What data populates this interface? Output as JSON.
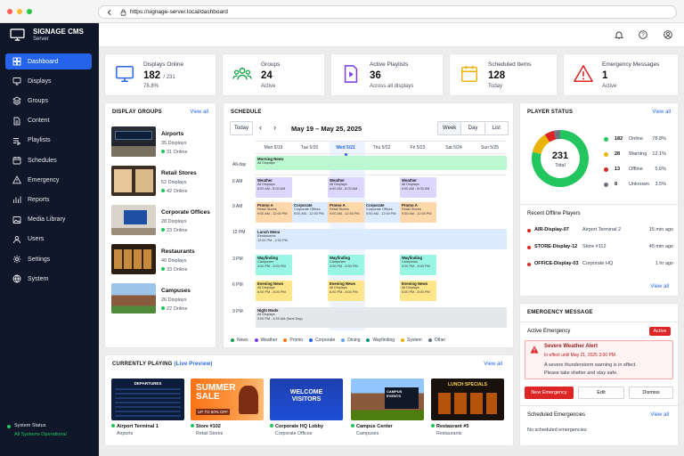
{
  "browser": {
    "url": "https://signage-server.local/dashboard"
  },
  "brand": {
    "title": "SIGNAGE CMS",
    "subtitle": "Server"
  },
  "nav": [
    {
      "label": "Dashboard",
      "icon": "grid-icon"
    },
    {
      "label": "Displays",
      "icon": "monitor-icon"
    },
    {
      "label": "Groups",
      "icon": "layers-icon"
    },
    {
      "label": "Content",
      "icon": "file-icon"
    },
    {
      "label": "Playlists",
      "icon": "playlist-icon"
    },
    {
      "label": "Schedules",
      "icon": "calendar-icon"
    },
    {
      "label": "Emergency",
      "icon": "warning-icon"
    },
    {
      "label": "Reports",
      "icon": "chart-icon"
    },
    {
      "label": "Media Library",
      "icon": "image-icon"
    },
    {
      "label": "Users",
      "icon": "user-icon"
    },
    {
      "label": "Settings",
      "icon": "gear-icon"
    },
    {
      "label": "System",
      "icon": "globe-icon"
    }
  ],
  "system_status": {
    "label": "System Status",
    "value": "All Systems Operational"
  },
  "stats": [
    {
      "label": "Displays Online",
      "value": "182",
      "value_extra": "/ 231",
      "sub": "78.8%",
      "icon": "monitor-icon"
    },
    {
      "label": "Groups",
      "value": "24",
      "sub": "Active",
      "icon": "users-icon"
    },
    {
      "label": "Active Playlists",
      "value": "36",
      "sub": "Across all displays",
      "icon": "play-file-icon"
    },
    {
      "label": "Scheduled Items",
      "value": "128",
      "sub": "Today",
      "icon": "calendar-icon"
    },
    {
      "label": "Emergency Messages",
      "value": "1",
      "sub": "Active",
      "icon": "alert-triangle-icon"
    }
  ],
  "display_groups": {
    "title": "DISPLAY GROUPS",
    "view_all": "View all",
    "items": [
      {
        "name": "Airports",
        "displays": "35 Displays",
        "online": "31 Online"
      },
      {
        "name": "Retail Stores",
        "displays": "52 Displays",
        "online": "42 Online"
      },
      {
        "name": "Corporate Offices",
        "displays": "28 Displays",
        "online": "23 Online"
      },
      {
        "name": "Restaurants",
        "displays": "40 Displays",
        "online": "33 Online"
      },
      {
        "name": "Campuses",
        "displays": "26 Displays",
        "online": "22 Online"
      }
    ]
  },
  "schedule": {
    "title": "SCHEDULE",
    "today": "Today",
    "range": "May 19 – May 25, 2025",
    "views": [
      "Week",
      "Day",
      "List"
    ],
    "days": [
      "Mon 5/19",
      "Tue 5/20",
      "Wed 5/21",
      "Thu 5/22",
      "Fri 5/23",
      "Sat 5/24",
      "Sun 5/25"
    ],
    "allday_label": "All-day",
    "times": [
      "6 AM",
      "9 AM",
      "12 PM",
      "3 PM",
      "6 PM",
      "9 PM"
    ],
    "legend": [
      "News",
      "Weather",
      "Promo",
      "Corporate",
      "Dining",
      "Wayfinding",
      "System",
      "Other"
    ],
    "legend_colors": [
      "#16a34a",
      "#7c3aed",
      "#f97316",
      "#2563eb",
      "#60a5fa",
      "#0d9488",
      "#eab308",
      "#6b7280"
    ]
  },
  "player_status": {
    "title": "PLAYER STATUS",
    "view_all": "View all",
    "total": "231",
    "total_label": "Total",
    "chart_data": {
      "type": "pie",
      "categories": [
        "Online",
        "Warning",
        "Offline",
        "Unknown"
      ],
      "values": [
        182,
        28,
        13,
        8
      ],
      "colors": [
        "#22c55e",
        "#eab308",
        "#dc2626",
        "#6b7280"
      ]
    },
    "rows": [
      {
        "count": "182",
        "label": "Online",
        "pct": "78.8%",
        "color": "#22c55e"
      },
      {
        "count": "28",
        "label": "Warning",
        "pct": "12.1%",
        "color": "#eab308"
      },
      {
        "count": "13",
        "label": "Offline",
        "pct": "5.6%",
        "color": "#dc2626"
      },
      {
        "count": "8",
        "label": "Unknown",
        "pct": "3.5%",
        "color": "#6b7280"
      }
    ],
    "offline_title": "Recent Offline Players",
    "offline": [
      {
        "name": "AIR-Display-07",
        "group": "Airport Terminal 2",
        "time": "15 min ago"
      },
      {
        "name": "STORE-Display-12",
        "group": "Store #112",
        "time": "45 min ago"
      },
      {
        "name": "OFFICE-Display-03",
        "group": "Corporate HQ",
        "time": "1 hr ago"
      }
    ],
    "offline_view_all": "View all"
  },
  "emergency": {
    "title": "EMERGENCY MESSAGE",
    "active_label": "Active Emergency",
    "badge": "Active",
    "alert_title": "Severe Weather Alert",
    "alert_time": "In effect until May 21, 2025 3:00 PM",
    "alert_line1": "A severe thunderstorm warning is in effect.",
    "alert_line2": "Please take shelter and stay safe.",
    "btn_new": "New Emergency",
    "btn_edit": "Edit",
    "btn_dismiss": "Dismiss",
    "scheduled_title": "Scheduled Emergencies",
    "view_all": "View all",
    "none": "No scheduled emergencies"
  },
  "playing": {
    "title": "CURRENTLY PLAYING",
    "live": "(Live Preview)",
    "view_all": "View all",
    "items": [
      {
        "name": "Airport Terminal 1",
        "group": "Airports",
        "screen": "DEPARTURES"
      },
      {
        "name": "Store #102",
        "group": "Retail Stores",
        "screen": "SUMMER SALE",
        "screen2": "UP TO 50% OFF"
      },
      {
        "name": "Corporate HQ Lobby",
        "group": "Corporate Offices",
        "screen": "WELCOME VISITORS"
      },
      {
        "name": "Campus Center",
        "group": "Campuses",
        "screen": "CAMPUS EVENTS"
      },
      {
        "name": "Restaurant #5",
        "group": "Restaurants",
        "screen": "LUNCH SPECIALS"
      }
    ]
  }
}
